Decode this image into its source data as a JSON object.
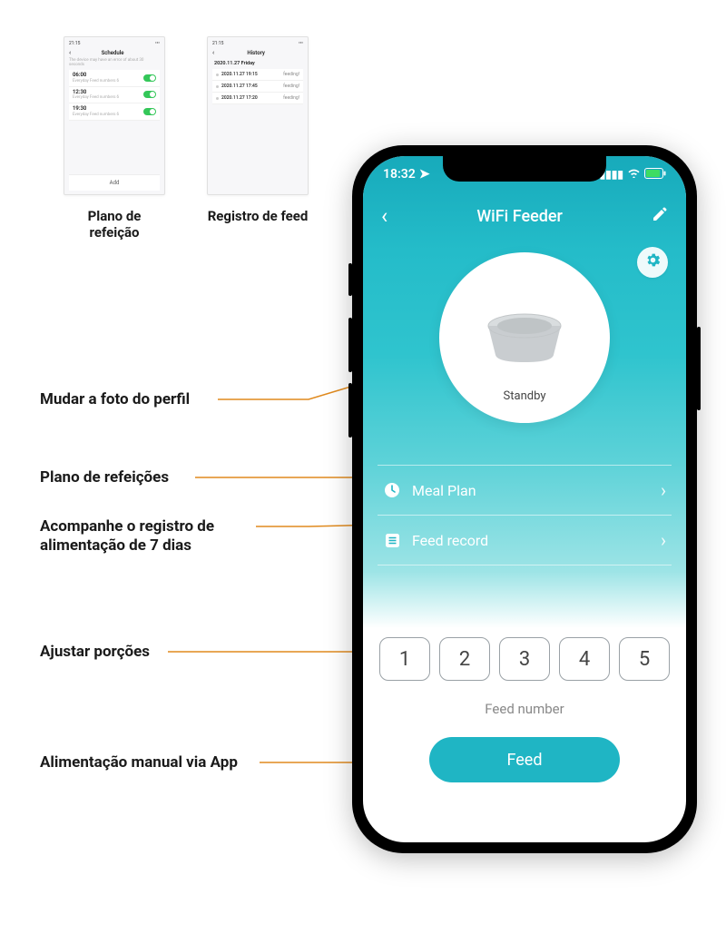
{
  "mini": {
    "schedule": {
      "status_time": "21:15",
      "title": "Schedule",
      "subhead": "The device may have an error of about 30 seconds",
      "rows": [
        {
          "time": "06:00",
          "sub": "Everyday  Feed numbers 6"
        },
        {
          "time": "12:30",
          "sub": "Everyday  Feed numbers 6"
        },
        {
          "time": "19:30",
          "sub": "Everyday  Feed numbers 6"
        }
      ],
      "add": "Add",
      "caption": "Plano de refeição"
    },
    "history": {
      "status_time": "21:15",
      "title": "History",
      "date_header": "2020.11.27 Friday",
      "rows": [
        {
          "stamp": "2020.11.27 19:15",
          "status": "feeding!"
        },
        {
          "stamp": "2020.11.27 17:45",
          "status": "feeding!"
        },
        {
          "stamp": "2020.11.27 17:20",
          "status": "feeding!"
        }
      ],
      "caption": "Registro de feed"
    }
  },
  "phone": {
    "status_time": "18:32",
    "title": "WiFi Feeder",
    "avatar_status": "Standby",
    "menu": {
      "meal_plan": "Meal Plan",
      "feed_record": "Feed record"
    },
    "portions": [
      "1",
      "2",
      "3",
      "4",
      "5"
    ],
    "feed_number_label": "Feed number",
    "feed_button": "Feed"
  },
  "callouts": {
    "c1": "Mudar a foto do perfil",
    "c2": "Plano de refeições",
    "c3": "Acompanhe o registro de alimentação de 7 dias",
    "c4": "Ajustar porções",
    "c5": "Alimentação manual via App"
  }
}
